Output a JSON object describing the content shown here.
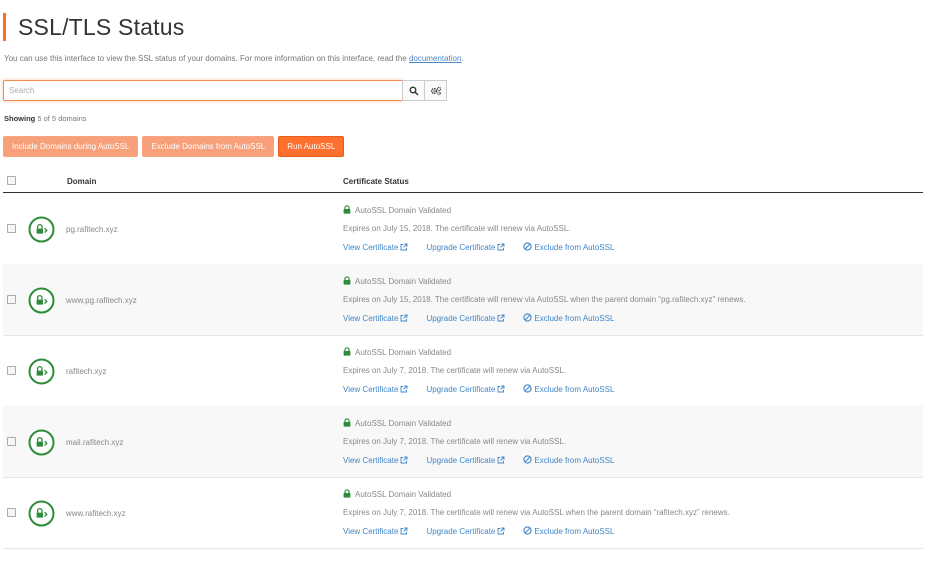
{
  "page": {
    "title": "SSL/TLS Status",
    "description": "You can use this interface to view the SSL status of your domains. For more information on this interface, read the ",
    "doc_link": "documentation",
    "doc_suffix": "."
  },
  "search": {
    "placeholder": "Search",
    "value": ""
  },
  "showing": {
    "label": "Showing",
    "text": "5 of 5 domains"
  },
  "actions": {
    "include": "Include Domains during AutoSSL",
    "exclude": "Exclude Domains from AutoSSL",
    "run": "Run AutoSSL"
  },
  "table": {
    "headers": {
      "domain": "Domain",
      "status": "Certificate Status"
    },
    "links": {
      "view": "View Certificate",
      "upgrade": "Upgrade Certificate",
      "exclude": "Exclude from AutoSSL"
    },
    "rows": [
      {
        "domain": "pg.rafitech.xyz",
        "status": "AutoSSL Domain Validated",
        "expires": "Expires on July 15, 2018. The certificate will renew via AutoSSL."
      },
      {
        "domain": "www.pg.rafitech.xyz",
        "status": "AutoSSL Domain Validated",
        "expires": "Expires on July 15, 2018. The certificate will renew via AutoSSL when the parent domain “pg.rafitech.xyz” renews."
      },
      {
        "domain": "rafitech.xyz",
        "status": "AutoSSL Domain Validated",
        "expires": "Expires on July 7, 2018. The certificate will renew via AutoSSL."
      },
      {
        "domain": "mail.rafitech.xyz",
        "status": "AutoSSL Domain Validated",
        "expires": "Expires on July 7, 2018. The certificate will renew via AutoSSL."
      },
      {
        "domain": "www.rafitech.xyz",
        "status": "AutoSSL Domain Validated",
        "expires": "Expires on July 7, 2018. The certificate will renew via AutoSSL when the parent domain “rafitech.xyz” renews."
      }
    ]
  },
  "colors": {
    "accent": "#ff6c2c",
    "link": "#3f86c7",
    "valid": "#2e8b3a"
  },
  "icons": [
    "search-icon",
    "settings-icon",
    "lock-icon",
    "external-link-icon",
    "ban-icon",
    "validated-badge-icon"
  ]
}
